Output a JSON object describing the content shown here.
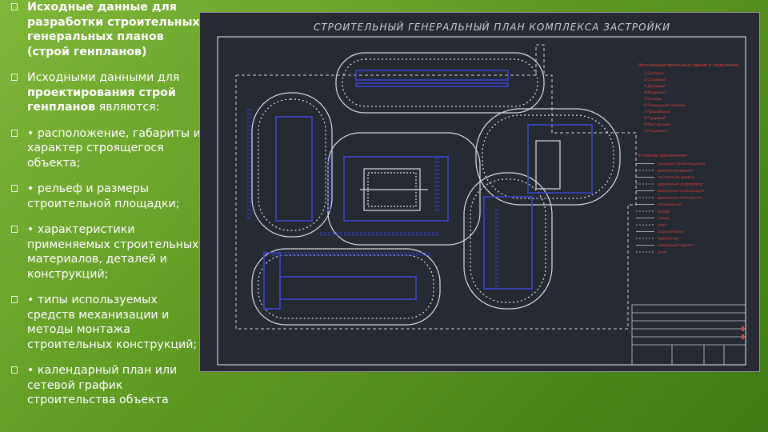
{
  "slide": {
    "bullets": [
      {
        "parts": [
          {
            "bold": true,
            "text": "Исходные данные для разработки строительных генеральных планов (строй генпланов)"
          }
        ]
      },
      {
        "parts": [
          {
            "bold": false,
            "text": "Исходными данными для "
          },
          {
            "bold": true,
            "text": "проектирования строй генпланов"
          },
          {
            "bold": false,
            "text": " являются:"
          }
        ]
      },
      {
        "parts": [
          {
            "bold": false,
            "text": "• расположение, габариты и характер строящегося объекта;"
          }
        ]
      },
      {
        "parts": [
          {
            "bold": false,
            "text": "• рельеф и размеры строительной площадки;"
          }
        ]
      },
      {
        "parts": [
          {
            "bold": false,
            "text": "• характеристики применяемых строительных материалов, деталей и конструкций;"
          }
        ]
      },
      {
        "parts": [
          {
            "bold": false,
            "text": "• типы используемых средств механизации и методы монтажа строительных конструкций;"
          }
        ]
      },
      {
        "parts": [
          {
            "bold": false,
            "text": "• календарный план или сетевой график строительства объекта"
          }
        ]
      }
    ]
  },
  "drawing": {
    "title": "СТРОИТЕЛЬНЫЙ ГЕНЕРАЛЬНЫЙ ПЛАН КОМПЛЕКСА ЗАСТРОЙКИ",
    "legend_title": "Экспликация временных зданий и сооружений",
    "legend_items": [
      "Бытовки",
      "Столовая",
      "Душевые",
      "Медпункт",
      "Склады",
      "Помещение охраны",
      "Прорабская",
      "Гардероб",
      "Мастерские",
      "Сушилка"
    ],
    "symbols_title": "Условные обозначения",
    "symbols": [
      "граница стройплощадки",
      "временная дорога",
      "постоянная дорога",
      "временный водопровод",
      "временная канализация",
      "временная электросеть",
      "ограждение",
      "въезд",
      "склад",
      "кран",
      "опасная зона",
      "прожектор",
      "пожарный гидрант",
      "знак"
    ],
    "colors": {
      "background": "#252a33",
      "lines": "#c9cbd4",
      "blue": "#3a43c8",
      "red": "#d8423a"
    }
  }
}
